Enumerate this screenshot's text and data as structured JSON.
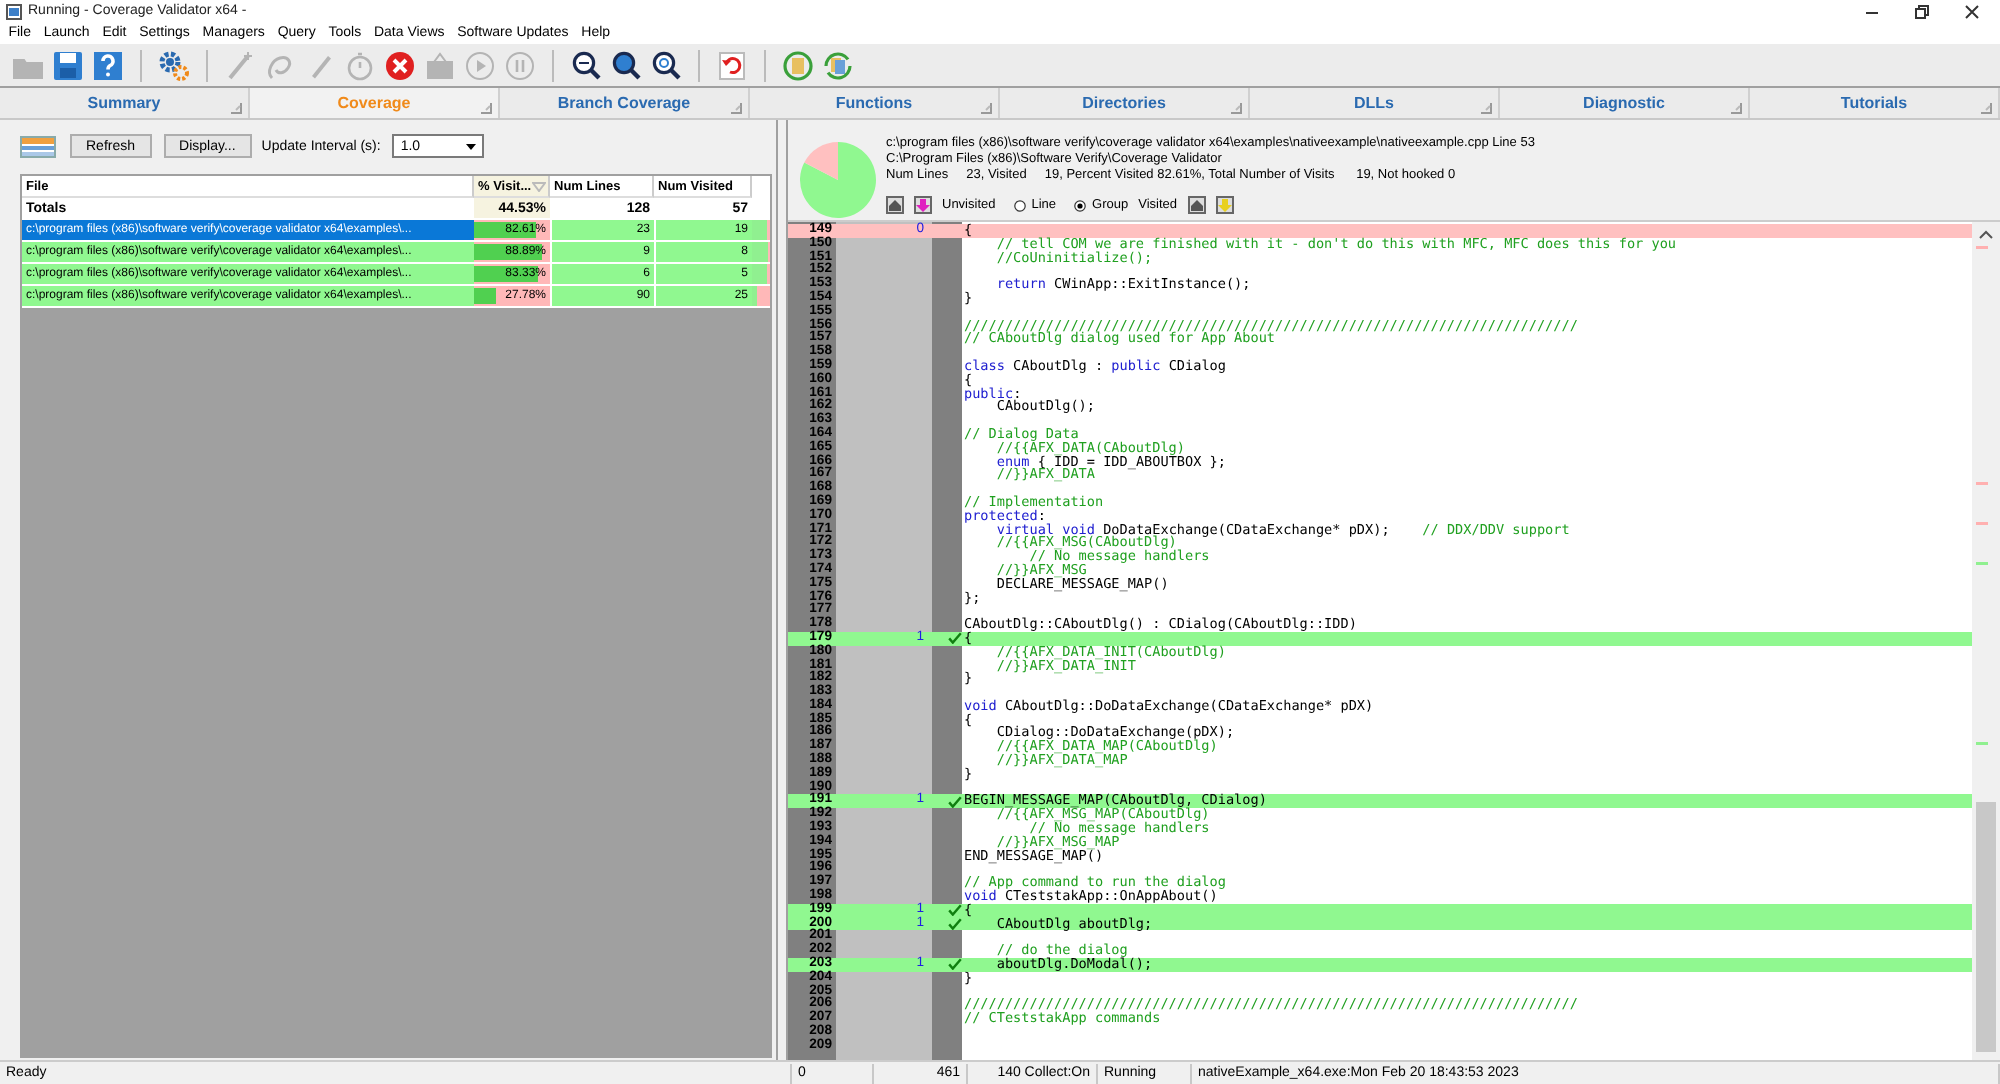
{
  "window": {
    "title": "Running - Coverage Validator x64 -"
  },
  "menu": [
    "File",
    "Launch",
    "Edit",
    "Settings",
    "Managers",
    "Query",
    "Tools",
    "Data Views",
    "Software Updates",
    "Help"
  ],
  "toolbar": [
    {
      "kind": "open",
      "disabled": true
    },
    {
      "kind": "save",
      "disabled": false
    },
    {
      "kind": "help",
      "disabled": false
    },
    {
      "kind": "separator"
    },
    {
      "kind": "settings",
      "disabled": false
    },
    {
      "kind": "separator"
    },
    {
      "kind": "wand",
      "disabled": true
    },
    {
      "kind": "hook",
      "disabled": true
    },
    {
      "kind": "pen",
      "disabled": true
    },
    {
      "kind": "timer",
      "disabled": true
    },
    {
      "kind": "stop",
      "disabled": false
    },
    {
      "kind": "package",
      "disabled": true
    },
    {
      "kind": "play",
      "disabled": true
    },
    {
      "kind": "pause",
      "disabled": true
    },
    {
      "kind": "separator"
    },
    {
      "kind": "zoom-lines",
      "disabled": false
    },
    {
      "kind": "zoom-fill",
      "disabled": false
    },
    {
      "kind": "zoom-ring",
      "disabled": false
    },
    {
      "kind": "separator"
    },
    {
      "kind": "undo",
      "disabled": false
    },
    {
      "kind": "separator"
    },
    {
      "kind": "refresh-doc",
      "disabled": false
    },
    {
      "kind": "refresh-docs",
      "disabled": false
    }
  ],
  "tabs": [
    {
      "label": "Summary",
      "selected": false
    },
    {
      "label": "Coverage",
      "selected": true
    },
    {
      "label": "Branch Coverage",
      "selected": false
    },
    {
      "label": "Functions",
      "selected": false
    },
    {
      "label": "Directories",
      "selected": false
    },
    {
      "label": "DLLs",
      "selected": false
    },
    {
      "label": "Diagnostic",
      "selected": false
    },
    {
      "label": "Tutorials",
      "selected": false
    }
  ],
  "left": {
    "refresh": "Refresh",
    "display": "Display...",
    "interval_label": "Update Interval (s):",
    "interval_value": "1.0",
    "table": {
      "columns": [
        "File",
        "% Visit...",
        "Num Lines",
        "Num Visited"
      ],
      "totals": [
        "Totals",
        "44.53%",
        "128",
        "57"
      ],
      "rows": [
        {
          "file": "c:\\program files (x86)\\software verify\\coverage validator x64\\examples\\...",
          "percent": "82.61%",
          "level": 0.8261,
          "lines": "23",
          "visited": "19",
          "selected": true
        },
        {
          "file": "c:\\program files (x86)\\software verify\\coverage validator x64\\examples\\...",
          "percent": "88.89%",
          "level": 0.8889,
          "lines": "9",
          "visited": "8",
          "selected": false
        },
        {
          "file": "c:\\program files (x86)\\software verify\\coverage validator x64\\examples\\...",
          "percent": "83.33%",
          "level": 0.8333,
          "lines": "6",
          "visited": "5",
          "selected": false
        },
        {
          "file": "c:\\program files (x86)\\software verify\\coverage validator x64\\examples\\...",
          "percent": "27.78%",
          "level": 0.2778,
          "lines": "90",
          "visited": "25",
          "selected": false
        }
      ]
    }
  },
  "right": {
    "info": {
      "chart_data": {
        "type": "pie",
        "values": [
          82.61,
          17.39
        ]
      },
      "path": "c:\\program files (x86)\\software verify\\coverage validator x64\\examples\\nativeexample\\nativeexample.cpp Line 53",
      "install": "C:\\Program Files (x86)\\Software Verify\\Coverage Validator",
      "stats": "Num Lines     23, Visited     19, Percent Visited 82.61%, Total Number of Visits      19, Not hooked 0"
    },
    "legend": {
      "unvisited_label": "Unvisited",
      "options": [
        {
          "label": "Line",
          "selected": false
        },
        {
          "label": "Group",
          "selected": true
        }
      ],
      "visited_label": "Visited"
    },
    "lines": [
      {
        "n": "149",
        "kind": "unvisited",
        "count": "0",
        "code": [
          {
            "kind": "plain",
            "text": "{"
          }
        ]
      },
      {
        "n": "150",
        "kind": "plain",
        "code": [
          {
            "kind": "comment",
            "text": "    // tell COM we are finished with it - don't do this with MFC, MFC does this for you"
          }
        ]
      },
      {
        "n": "151",
        "kind": "plain",
        "code": [
          {
            "kind": "comment",
            "text": "    //CoUninitialize();"
          }
        ]
      },
      {
        "n": "152",
        "kind": "plain"
      },
      {
        "n": "153",
        "kind": "plain",
        "code": [
          {
            "kind": "keyword",
            "text": "    return"
          },
          {
            "kind": "plain",
            "text": " CWinApp::ExitInstance();"
          }
        ]
      },
      {
        "n": "154",
        "kind": "plain",
        "code": [
          {
            "kind": "plain",
            "text": "}"
          }
        ]
      },
      {
        "n": "155",
        "kind": "plain"
      },
      {
        "n": "156",
        "kind": "plain",
        "code": [
          {
            "kind": "comment",
            "text": "///////////////////////////////////////////////////////////////////////////"
          }
        ]
      },
      {
        "n": "157",
        "kind": "plain",
        "code": [
          {
            "kind": "comment",
            "text": "// CAboutDlg dialog used for App About"
          }
        ]
      },
      {
        "n": "158",
        "kind": "plain"
      },
      {
        "n": "159",
        "kind": "plain",
        "code": [
          {
            "kind": "keyword",
            "text": "class"
          },
          {
            "kind": "plain",
            "text": " CAboutDlg : "
          },
          {
            "kind": "keyword",
            "text": "public"
          },
          {
            "kind": "plain",
            "text": " CDialog"
          }
        ]
      },
      {
        "n": "160",
        "kind": "plain",
        "code": [
          {
            "kind": "plain",
            "text": "{"
          }
        ]
      },
      {
        "n": "161",
        "kind": "plain",
        "code": [
          {
            "kind": "keyword",
            "text": "public"
          },
          {
            "kind": "plain",
            "text": ":"
          }
        ]
      },
      {
        "n": "162",
        "kind": "plain",
        "code": [
          {
            "kind": "plain",
            "text": "    CAboutDlg();"
          }
        ]
      },
      {
        "n": "163",
        "kind": "plain"
      },
      {
        "n": "164",
        "kind": "plain",
        "code": [
          {
            "kind": "comment",
            "text": "// Dialog Data"
          }
        ]
      },
      {
        "n": "165",
        "kind": "plain",
        "code": [
          {
            "kind": "comment",
            "text": "    //{{AFX_DATA(CAboutDlg)"
          }
        ]
      },
      {
        "n": "166",
        "kind": "plain",
        "code": [
          {
            "kind": "keyword",
            "text": "    enum"
          },
          {
            "kind": "plain",
            "text": " { IDD = IDD_ABOUTBOX };"
          }
        ]
      },
      {
        "n": "167",
        "kind": "plain",
        "code": [
          {
            "kind": "comment",
            "text": "    //}}AFX_DATA"
          }
        ]
      },
      {
        "n": "168",
        "kind": "plain"
      },
      {
        "n": "169",
        "kind": "plain",
        "code": [
          {
            "kind": "comment",
            "text": "// Implementation"
          }
        ]
      },
      {
        "n": "170",
        "kind": "plain",
        "code": [
          {
            "kind": "keyword",
            "text": "protected"
          },
          {
            "kind": "plain",
            "text": ":"
          }
        ]
      },
      {
        "n": "171",
        "kind": "plain",
        "code": [
          {
            "kind": "keyword",
            "text": "    virtual void"
          },
          {
            "kind": "plain",
            "text": " DoDataExchange(CDataExchange* pDX);    "
          },
          {
            "kind": "comment",
            "text": "// DDX/DDV support"
          }
        ]
      },
      {
        "n": "172",
        "kind": "plain",
        "code": [
          {
            "kind": "comment",
            "text": "    //{{AFX_MSG(CAboutDlg)"
          }
        ]
      },
      {
        "n": "173",
        "kind": "plain",
        "code": [
          {
            "kind": "comment",
            "text": "        // No message handlers"
          }
        ]
      },
      {
        "n": "174",
        "kind": "plain",
        "code": [
          {
            "kind": "comment",
            "text": "    //}}AFX_MSG"
          }
        ]
      },
      {
        "n": "175",
        "kind": "plain",
        "code": [
          {
            "kind": "plain",
            "text": "    DECLARE_MESSAGE_MAP()"
          }
        ]
      },
      {
        "n": "176",
        "kind": "plain",
        "code": [
          {
            "kind": "plain",
            "text": "};"
          }
        ]
      },
      {
        "n": "177",
        "kind": "plain"
      },
      {
        "n": "178",
        "kind": "plain",
        "code": [
          {
            "kind": "plain",
            "text": "CAboutDlg::CAboutDlg() : CDialog(CAboutDlg::IDD)"
          }
        ]
      },
      {
        "n": "179",
        "kind": "visited",
        "count": "1",
        "code": [
          {
            "kind": "plain",
            "text": "{"
          }
        ]
      },
      {
        "n": "180",
        "kind": "plain",
        "code": [
          {
            "kind": "comment",
            "text": "    //{{AFX_DATA_INIT(CAboutDlg)"
          }
        ]
      },
      {
        "n": "181",
        "kind": "plain",
        "code": [
          {
            "kind": "comment",
            "text": "    //}}AFX_DATA_INIT"
          }
        ]
      },
      {
        "n": "182",
        "kind": "plain",
        "code": [
          {
            "kind": "plain",
            "text": "}"
          }
        ]
      },
      {
        "n": "183",
        "kind": "plain"
      },
      {
        "n": "184",
        "kind": "plain",
        "code": [
          {
            "kind": "keyword",
            "text": "void"
          },
          {
            "kind": "plain",
            "text": " CAboutDlg::DoDataExchange(CDataExchange* pDX)"
          }
        ]
      },
      {
        "n": "185",
        "kind": "plain",
        "code": [
          {
            "kind": "plain",
            "text": "{"
          }
        ]
      },
      {
        "n": "186",
        "kind": "plain",
        "code": [
          {
            "kind": "plain",
            "text": "    CDialog::DoDataExchange(pDX);"
          }
        ]
      },
      {
        "n": "187",
        "kind": "plain",
        "code": [
          {
            "kind": "comment",
            "text": "    //{{AFX_DATA_MAP(CAboutDlg)"
          }
        ]
      },
      {
        "n": "188",
        "kind": "plain",
        "code": [
          {
            "kind": "comment",
            "text": "    //}}AFX_DATA_MAP"
          }
        ]
      },
      {
        "n": "189",
        "kind": "plain",
        "code": [
          {
            "kind": "plain",
            "text": "}"
          }
        ]
      },
      {
        "n": "190",
        "kind": "plain"
      },
      {
        "n": "191",
        "kind": "visited",
        "count": "1",
        "code": [
          {
            "kind": "plain",
            "text": "BEGIN_MESSAGE_MAP(CAboutDlg, CDialog)"
          }
        ]
      },
      {
        "n": "192",
        "kind": "plain",
        "code": [
          {
            "kind": "comment",
            "text": "    //{{AFX_MSG_MAP(CAboutDlg)"
          }
        ]
      },
      {
        "n": "193",
        "kind": "plain",
        "code": [
          {
            "kind": "comment",
            "text": "        // No message handlers"
          }
        ]
      },
      {
        "n": "194",
        "kind": "plain",
        "code": [
          {
            "kind": "comment",
            "text": "    //}}AFX_MSG_MAP"
          }
        ]
      },
      {
        "n": "195",
        "kind": "plain",
        "code": [
          {
            "kind": "plain",
            "text": "END_MESSAGE_MAP()"
          }
        ]
      },
      {
        "n": "196",
        "kind": "plain"
      },
      {
        "n": "197",
        "kind": "plain",
        "code": [
          {
            "kind": "comment",
            "text": "// App command to run the dialog"
          }
        ]
      },
      {
        "n": "198",
        "kind": "plain",
        "code": [
          {
            "kind": "keyword",
            "text": "void"
          },
          {
            "kind": "plain",
            "text": " CTeststakApp::OnAppAbout()"
          }
        ]
      },
      {
        "n": "199",
        "kind": "visited",
        "count": "1",
        "code": [
          {
            "kind": "plain",
            "text": "{"
          }
        ]
      },
      {
        "n": "200",
        "kind": "visited",
        "count": "1",
        "code": [
          {
            "kind": "plain",
            "text": "    CAboutDlg aboutDlg;"
          }
        ]
      },
      {
        "n": "201",
        "kind": "plain"
      },
      {
        "n": "202",
        "kind": "plain",
        "code": [
          {
            "kind": "comment",
            "text": "    // do the dialog"
          }
        ]
      },
      {
        "n": "203",
        "kind": "visited",
        "count": "1",
        "code": [
          {
            "kind": "plain",
            "text": "    aboutDlg.DoModal();"
          }
        ]
      },
      {
        "n": "204",
        "kind": "plain",
        "code": [
          {
            "kind": "plain",
            "text": "}"
          }
        ]
      },
      {
        "n": "205",
        "kind": "plain"
      },
      {
        "n": "206",
        "kind": "plain",
        "code": [
          {
            "kind": "comment",
            "text": "///////////////////////////////////////////////////////////////////////////"
          }
        ]
      },
      {
        "n": "207",
        "kind": "plain",
        "code": [
          {
            "kind": "comment",
            "text": "// CTeststakApp commands"
          }
        ]
      },
      {
        "n": "208",
        "kind": "plain"
      },
      {
        "n": "209",
        "kind": "plain"
      }
    ]
  },
  "status_bar": [
    "Ready",
    "0",
    "461",
    "140 Collect:On",
    "Running",
    "nativeExample_x64.exe:Mon Feb 20 18:43:53 2023"
  ]
}
